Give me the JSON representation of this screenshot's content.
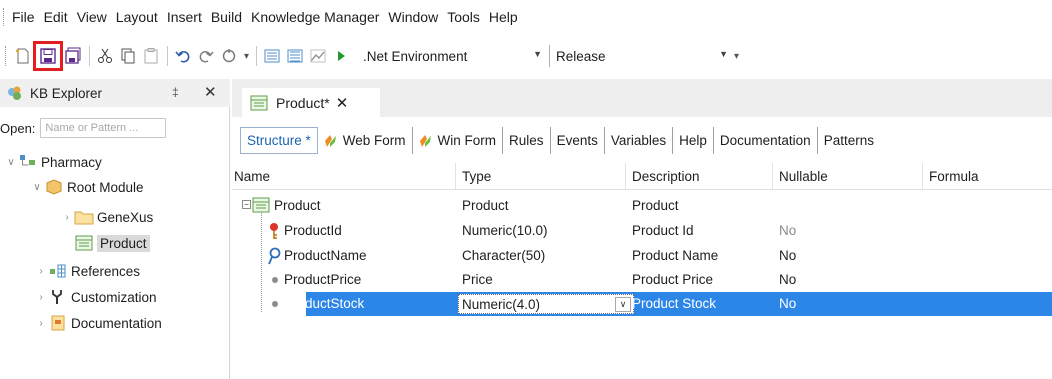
{
  "menu": {
    "items": [
      "File",
      "Edit",
      "View",
      "Layout",
      "Insert",
      "Build",
      "Knowledge Manager",
      "Window",
      "Tools",
      "Help"
    ]
  },
  "toolbar": {
    "environment": ".Net Environment",
    "configuration": "Release",
    "icons": [
      "new-object-icon",
      "save-icon",
      "save-all-icon",
      "cut-icon",
      "copy-icon",
      "paste-icon",
      "undo-icon",
      "redo-icon",
      "refresh-icon",
      "build-icon",
      "build-all-icon",
      "reorganize-icon",
      "run-icon"
    ],
    "highlight_color": "#e11d1d"
  },
  "kb_explorer": {
    "title": "KB Explorer",
    "open_label": "Open:",
    "open_placeholder": "Name or Pattern ...",
    "tree": {
      "root": "Pharmacy",
      "root_module": "Root Module",
      "genexus": "GeneXus",
      "product": "Product",
      "references": "References",
      "customization": "Customization",
      "documentation": "Documentation"
    }
  },
  "editor": {
    "tab_title": "Product",
    "tab_modified": "*",
    "subtabs": {
      "structure": "Structure *",
      "web_form": "Web Form",
      "win_form": "Win Form",
      "rules": "Rules",
      "events": "Events",
      "variables": "Variables",
      "help": "Help",
      "documentation": "Documentation",
      "patterns": "Patterns"
    },
    "columns": {
      "name": "Name",
      "type": "Type",
      "description": "Description",
      "nullable": "Nullable",
      "formula": "Formula"
    },
    "rows": [
      {
        "name": "Product",
        "type": "Product",
        "description": "Product",
        "nullable": ""
      },
      {
        "name": "ProductId",
        "type": "Numeric(10.0)",
        "description": "Product Id",
        "nullable": "No"
      },
      {
        "name": "ProductName",
        "type": "Character(50)",
        "description": "Product Name",
        "nullable": "No"
      },
      {
        "name": "ProductPrice",
        "type": "Price",
        "description": "Product Price",
        "nullable": "No"
      },
      {
        "name": "ProductStock",
        "type": "Numeric(4.0)",
        "description": "Product Stock",
        "nullable": "No"
      }
    ],
    "accent_color": "#1d63b5",
    "selection_color": "#2c86e8"
  }
}
